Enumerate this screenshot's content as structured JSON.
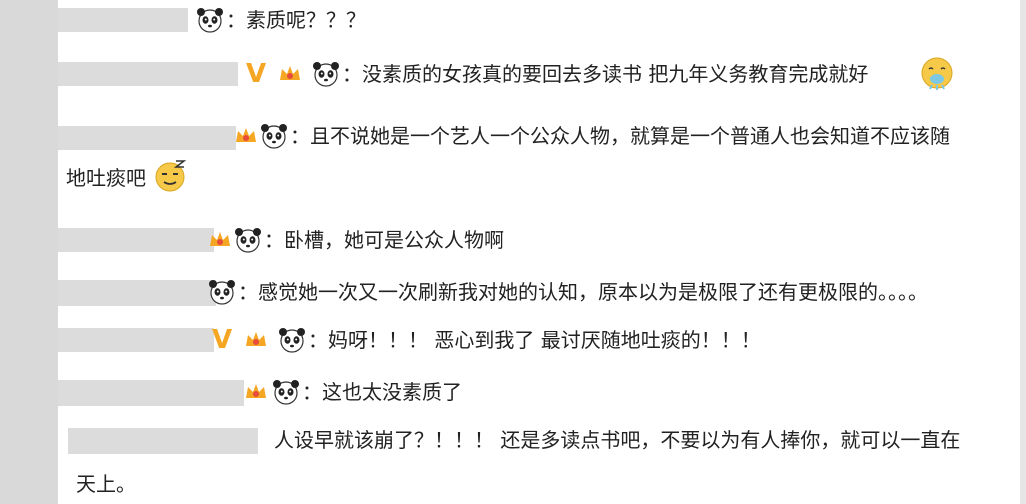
{
  "comments": [
    {
      "text": "素质呢？？？"
    },
    {
      "badge": "V",
      "text": "没素质的女孩真的要回去多读书 把九年义务教育完成就好"
    },
    {
      "text_line1": "且不说她是一个艺人一个公众人物，就算是一个普通人也会知道不应该随",
      "text_line2": "地吐痰吧"
    },
    {
      "text": "卧槽，她可是公众人物啊"
    },
    {
      "text": "感觉她一次又一次刷新我对她的认知，原本以为是极限了还有更极限的。。。。"
    },
    {
      "badge": "V",
      "text": "妈呀！！！ 恶心到我了 最讨厌随地吐痰的！！！"
    },
    {
      "text": "这也太没素质了"
    },
    {
      "text_line1": "人设早就该崩了？！！！ 还是多读点书吧，不要以为有人捧你，就可以一直在",
      "text_line2": "天上。"
    }
  ],
  "colors": {
    "redaction": "#dcdcdc",
    "vip_badge": "#f5a623",
    "crown": "#f5a623",
    "text": "#222222"
  },
  "icons": [
    "panda-icon",
    "crown-badge-icon",
    "vip-v-badge",
    "vomit-emoji",
    "dizzy-emoji"
  ]
}
